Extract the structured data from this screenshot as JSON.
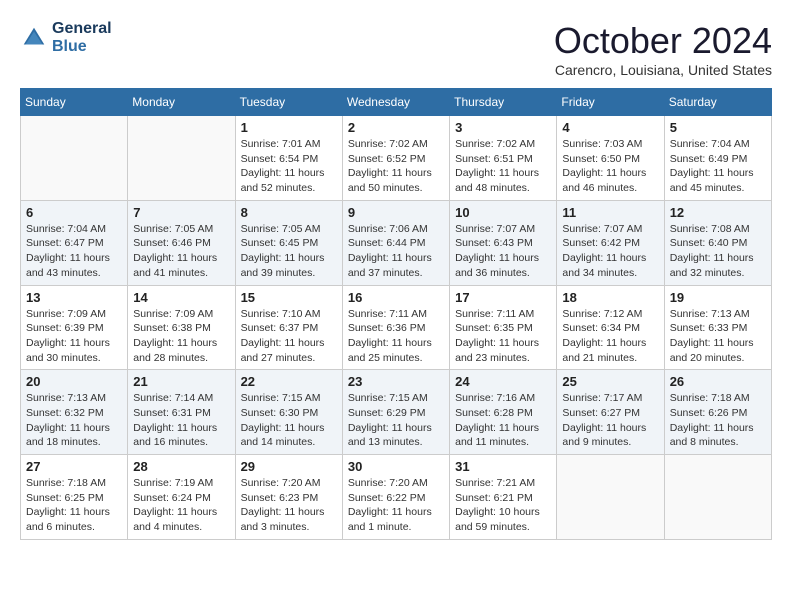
{
  "header": {
    "logo_line1": "General",
    "logo_line2": "Blue",
    "month": "October 2024",
    "location": "Carencro, Louisiana, United States"
  },
  "weekdays": [
    "Sunday",
    "Monday",
    "Tuesday",
    "Wednesday",
    "Thursday",
    "Friday",
    "Saturday"
  ],
  "weeks": [
    [
      {
        "day": "",
        "info": ""
      },
      {
        "day": "",
        "info": ""
      },
      {
        "day": "1",
        "info": "Sunrise: 7:01 AM\nSunset: 6:54 PM\nDaylight: 11 hours and 52 minutes."
      },
      {
        "day": "2",
        "info": "Sunrise: 7:02 AM\nSunset: 6:52 PM\nDaylight: 11 hours and 50 minutes."
      },
      {
        "day": "3",
        "info": "Sunrise: 7:02 AM\nSunset: 6:51 PM\nDaylight: 11 hours and 48 minutes."
      },
      {
        "day": "4",
        "info": "Sunrise: 7:03 AM\nSunset: 6:50 PM\nDaylight: 11 hours and 46 minutes."
      },
      {
        "day": "5",
        "info": "Sunrise: 7:04 AM\nSunset: 6:49 PM\nDaylight: 11 hours and 45 minutes."
      }
    ],
    [
      {
        "day": "6",
        "info": "Sunrise: 7:04 AM\nSunset: 6:47 PM\nDaylight: 11 hours and 43 minutes."
      },
      {
        "day": "7",
        "info": "Sunrise: 7:05 AM\nSunset: 6:46 PM\nDaylight: 11 hours and 41 minutes."
      },
      {
        "day": "8",
        "info": "Sunrise: 7:05 AM\nSunset: 6:45 PM\nDaylight: 11 hours and 39 minutes."
      },
      {
        "day": "9",
        "info": "Sunrise: 7:06 AM\nSunset: 6:44 PM\nDaylight: 11 hours and 37 minutes."
      },
      {
        "day": "10",
        "info": "Sunrise: 7:07 AM\nSunset: 6:43 PM\nDaylight: 11 hours and 36 minutes."
      },
      {
        "day": "11",
        "info": "Sunrise: 7:07 AM\nSunset: 6:42 PM\nDaylight: 11 hours and 34 minutes."
      },
      {
        "day": "12",
        "info": "Sunrise: 7:08 AM\nSunset: 6:40 PM\nDaylight: 11 hours and 32 minutes."
      }
    ],
    [
      {
        "day": "13",
        "info": "Sunrise: 7:09 AM\nSunset: 6:39 PM\nDaylight: 11 hours and 30 minutes."
      },
      {
        "day": "14",
        "info": "Sunrise: 7:09 AM\nSunset: 6:38 PM\nDaylight: 11 hours and 28 minutes."
      },
      {
        "day": "15",
        "info": "Sunrise: 7:10 AM\nSunset: 6:37 PM\nDaylight: 11 hours and 27 minutes."
      },
      {
        "day": "16",
        "info": "Sunrise: 7:11 AM\nSunset: 6:36 PM\nDaylight: 11 hours and 25 minutes."
      },
      {
        "day": "17",
        "info": "Sunrise: 7:11 AM\nSunset: 6:35 PM\nDaylight: 11 hours and 23 minutes."
      },
      {
        "day": "18",
        "info": "Sunrise: 7:12 AM\nSunset: 6:34 PM\nDaylight: 11 hours and 21 minutes."
      },
      {
        "day": "19",
        "info": "Sunrise: 7:13 AM\nSunset: 6:33 PM\nDaylight: 11 hours and 20 minutes."
      }
    ],
    [
      {
        "day": "20",
        "info": "Sunrise: 7:13 AM\nSunset: 6:32 PM\nDaylight: 11 hours and 18 minutes."
      },
      {
        "day": "21",
        "info": "Sunrise: 7:14 AM\nSunset: 6:31 PM\nDaylight: 11 hours and 16 minutes."
      },
      {
        "day": "22",
        "info": "Sunrise: 7:15 AM\nSunset: 6:30 PM\nDaylight: 11 hours and 14 minutes."
      },
      {
        "day": "23",
        "info": "Sunrise: 7:15 AM\nSunset: 6:29 PM\nDaylight: 11 hours and 13 minutes."
      },
      {
        "day": "24",
        "info": "Sunrise: 7:16 AM\nSunset: 6:28 PM\nDaylight: 11 hours and 11 minutes."
      },
      {
        "day": "25",
        "info": "Sunrise: 7:17 AM\nSunset: 6:27 PM\nDaylight: 11 hours and 9 minutes."
      },
      {
        "day": "26",
        "info": "Sunrise: 7:18 AM\nSunset: 6:26 PM\nDaylight: 11 hours and 8 minutes."
      }
    ],
    [
      {
        "day": "27",
        "info": "Sunrise: 7:18 AM\nSunset: 6:25 PM\nDaylight: 11 hours and 6 minutes."
      },
      {
        "day": "28",
        "info": "Sunrise: 7:19 AM\nSunset: 6:24 PM\nDaylight: 11 hours and 4 minutes."
      },
      {
        "day": "29",
        "info": "Sunrise: 7:20 AM\nSunset: 6:23 PM\nDaylight: 11 hours and 3 minutes."
      },
      {
        "day": "30",
        "info": "Sunrise: 7:20 AM\nSunset: 6:22 PM\nDaylight: 11 hours and 1 minute."
      },
      {
        "day": "31",
        "info": "Sunrise: 7:21 AM\nSunset: 6:21 PM\nDaylight: 10 hours and 59 minutes."
      },
      {
        "day": "",
        "info": ""
      },
      {
        "day": "",
        "info": ""
      }
    ]
  ]
}
